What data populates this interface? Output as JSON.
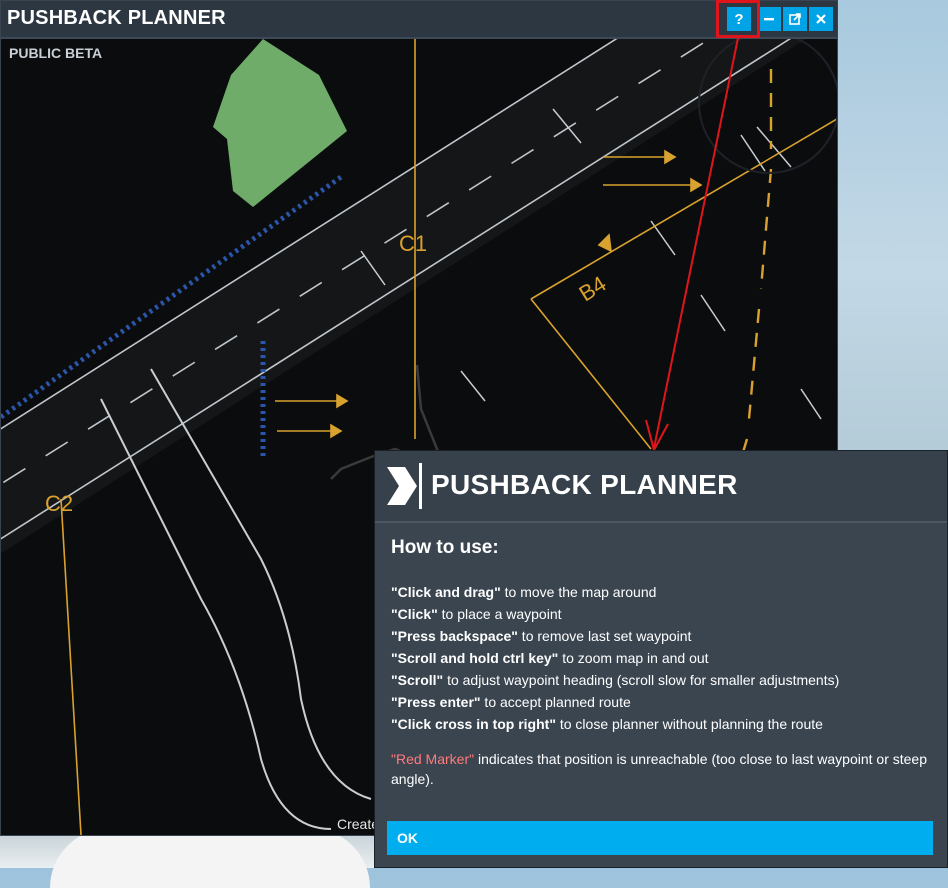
{
  "window": {
    "title": "PUSHBACK PLANNER",
    "subtitle": "PUBLIC BETA",
    "buttons": {
      "help": "?",
      "minimize": "minimize-icon",
      "popout": "popout-icon",
      "close": "close-icon"
    }
  },
  "map": {
    "taxiway_labels": [
      "C1",
      "C2",
      "B4"
    ],
    "bottom_text": "Create"
  },
  "help": {
    "title": "PUSHBACK PLANNER",
    "heading": "How to use:",
    "instructions": [
      {
        "key": "\"Click and drag\"",
        "desc": " to move the map around"
      },
      {
        "key": "\"Click\"",
        "desc": " to place a waypoint"
      },
      {
        "key": "\"Press backspace\"",
        "desc": " to remove last set waypoint"
      },
      {
        "key": "\"Scroll and hold ctrl key\"",
        "desc": " to zoom map in and out"
      },
      {
        "key": "\"Scroll\"",
        "desc": " to adjust waypoint heading (scroll slow for smaller adjustments)"
      },
      {
        "key": "\"Press enter\"",
        "desc": " to accept planned route"
      },
      {
        "key": "\"Click cross in top right\"",
        "desc": " to close planner without planning the route"
      }
    ],
    "note_key": "\"Red Marker\"",
    "note_text": " indicates that position is unreachable (too close to last waypoint or steep angle).",
    "ok_label": "OK"
  },
  "colors": {
    "accent": "#00a3e6",
    "title_bar": "#2d3742",
    "dialog_bg": "#3a4550",
    "highlight_red": "#e0151b",
    "marker_red": "#ff7b7b",
    "taxi_yellow": "#d9a22e"
  }
}
